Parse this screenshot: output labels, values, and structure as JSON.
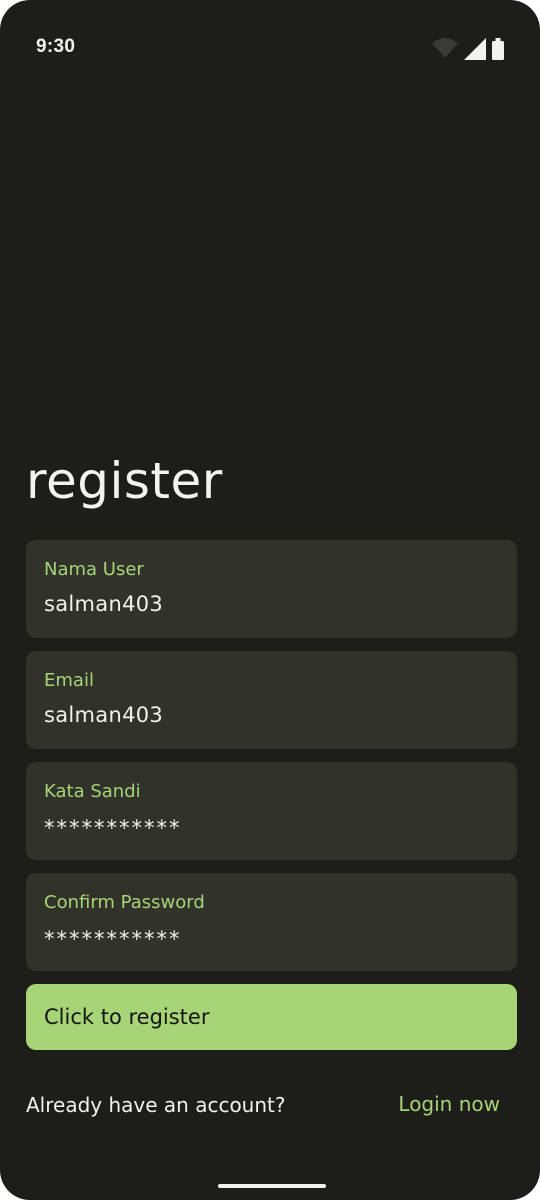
{
  "status_bar": {
    "time": "9:30",
    "icons": [
      "wifi-icon",
      "cellular-signal-icon",
      "battery-icon"
    ]
  },
  "screen": {
    "title": "register"
  },
  "form": {
    "username": {
      "label": "Nama User",
      "value": "salman403"
    },
    "email": {
      "label": "Email",
      "value": "salman403"
    },
    "password": {
      "label": "Kata Sandi",
      "value": "***********"
    },
    "confirm_password": {
      "label": "Confirm Password",
      "value": "***********"
    },
    "submit_label": "Click to register"
  },
  "footer": {
    "question": "Already have an account?",
    "login_link": "Login now"
  },
  "colors": {
    "background": "#1d1d1a",
    "field_background": "#31332b",
    "accent": "#a6d476",
    "text": "#f2f2ee"
  }
}
